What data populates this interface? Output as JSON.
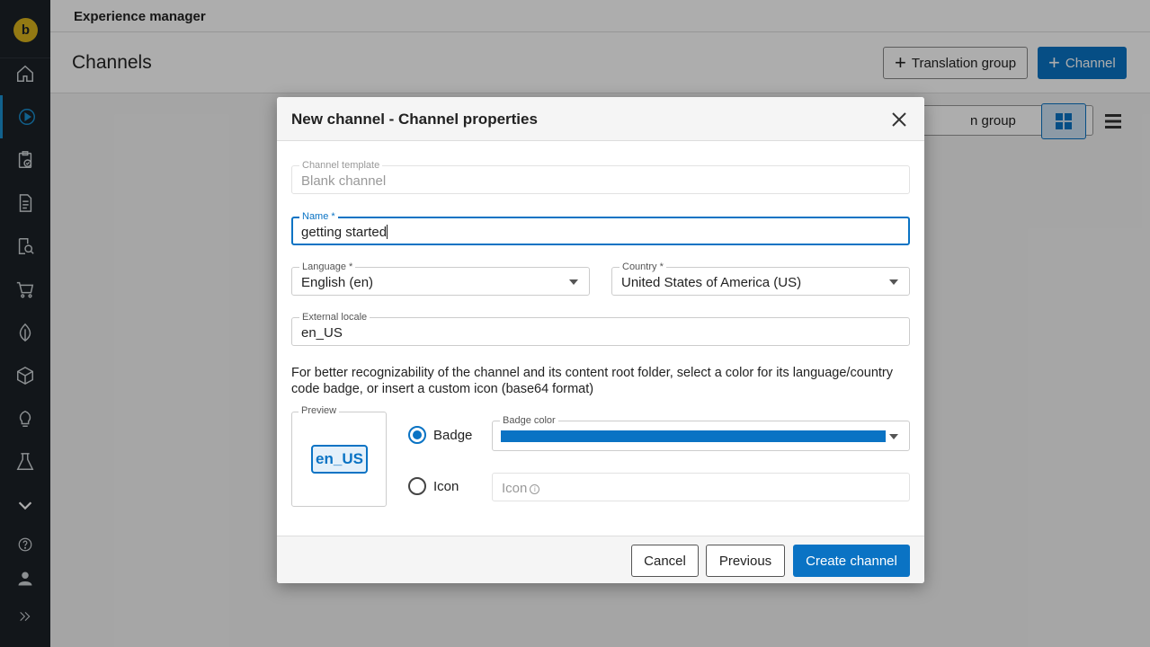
{
  "app": {
    "title": "Experience manager",
    "logo_letter": "b"
  },
  "page": {
    "title": "Channels",
    "translation_group_button": "Translation group",
    "channel_button": "Channel",
    "filter_select_visible_text": "n group"
  },
  "sidebar": {
    "items": [
      {
        "icon": "home-icon"
      },
      {
        "icon": "play-circle-icon",
        "active": true
      },
      {
        "icon": "clipboard-check-icon"
      },
      {
        "icon": "document-icon"
      },
      {
        "icon": "document-search-icon"
      },
      {
        "icon": "cart-icon"
      },
      {
        "icon": "leaf-icon"
      },
      {
        "icon": "cube-icon"
      },
      {
        "icon": "lightbulb-icon"
      },
      {
        "icon": "flask-icon"
      },
      {
        "icon": "chevron-down-icon"
      },
      {
        "icon": "help-icon"
      },
      {
        "icon": "user-icon"
      },
      {
        "icon": "expand-icon"
      }
    ]
  },
  "modal": {
    "title": "New channel - Channel properties",
    "channel_template": {
      "label": "Channel template",
      "value": "Blank channel"
    },
    "name": {
      "label": "Name *",
      "value": "getting started"
    },
    "language": {
      "label": "Language *",
      "value": "English (en)"
    },
    "country": {
      "label": "Country *",
      "value": "United States of America (US)"
    },
    "external_locale": {
      "label": "External locale",
      "value": "en_US"
    },
    "hint": "For better recognizability of the channel and its content root folder, select a color for its language/country code badge, or insert a custom icon (base64 format)",
    "preview": {
      "label": "Preview",
      "badge_text": "en_US"
    },
    "badge_option": {
      "label": "Badge",
      "selected": true
    },
    "icon_option": {
      "label": "Icon",
      "selected": false
    },
    "badge_color": {
      "label": "Badge color",
      "color": "#0a73c4"
    },
    "icon_field": {
      "placeholder": "Icon"
    },
    "buttons": {
      "cancel": "Cancel",
      "previous": "Previous",
      "create": "Create channel"
    }
  }
}
